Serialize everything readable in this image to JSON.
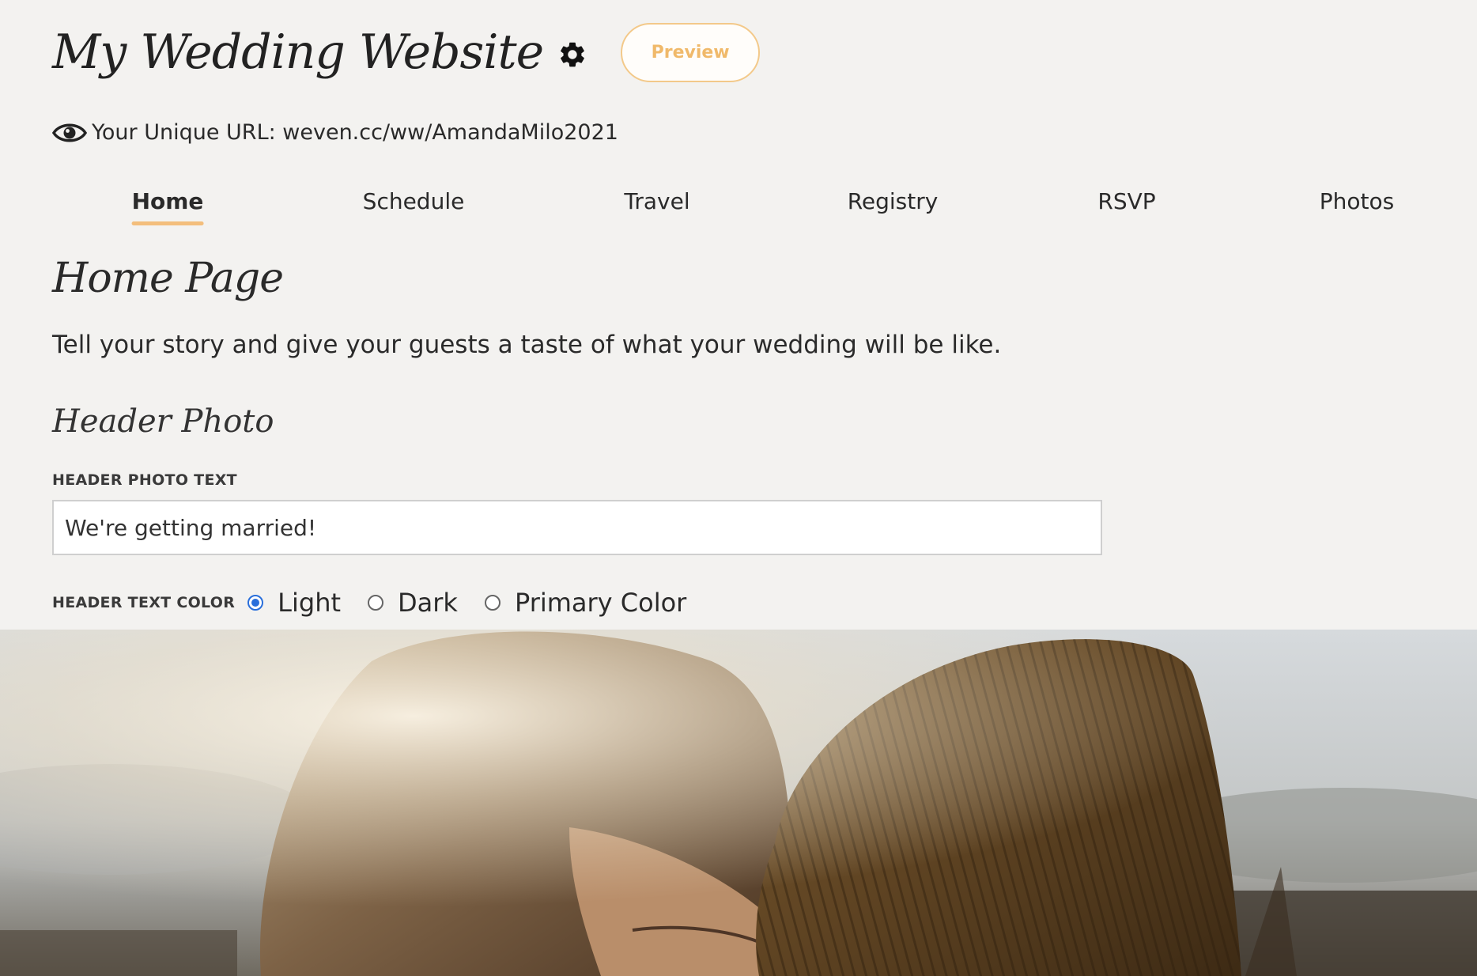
{
  "header": {
    "site_title": "My Wedding Website",
    "preview_label": "Preview",
    "url_text": "Your Unique URL: weven.cc/ww/AmandaMilo2021"
  },
  "nav": {
    "tabs": [
      {
        "label": "Home",
        "active": true
      },
      {
        "label": "Schedule",
        "active": false
      },
      {
        "label": "Travel",
        "active": false
      },
      {
        "label": "Registry",
        "active": false
      },
      {
        "label": "RSVP",
        "active": false
      },
      {
        "label": "Photos",
        "active": false
      }
    ]
  },
  "main": {
    "page_title": "Home Page",
    "intro": "Tell your story and give your guests a taste of what your wedding will be like.",
    "section_title": "Header Photo",
    "header_photo_text_label": "HEADER PHOTO TEXT",
    "header_photo_text_value": "We're getting married!",
    "header_text_color_label": "HEADER TEXT COLOR",
    "color_options": [
      {
        "label": "Light",
        "checked": true
      },
      {
        "label": "Dark",
        "checked": false
      },
      {
        "label": "Primary Color",
        "checked": false
      }
    ]
  },
  "colors": {
    "accent": "#f3be7c",
    "radio_selected": "#2a6fdb",
    "background": "#f3f2f0"
  },
  "icons": {
    "settings": "gear-icon",
    "visibility": "eye-icon"
  }
}
